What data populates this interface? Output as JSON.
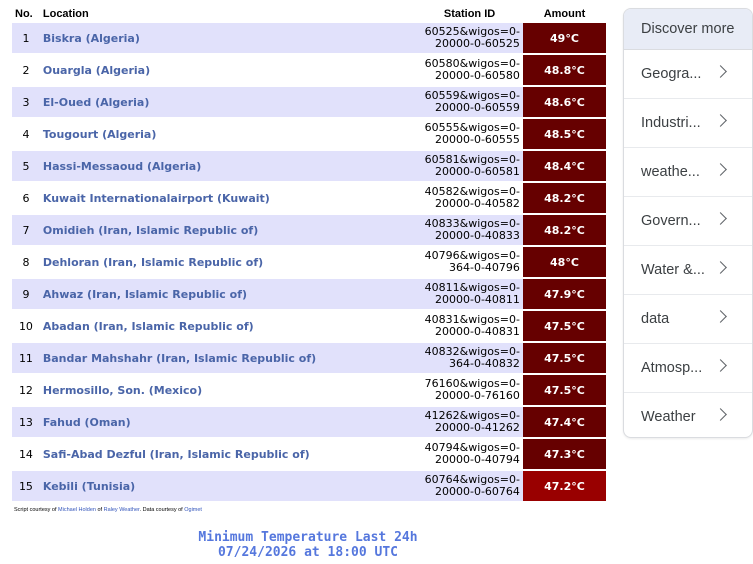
{
  "table": {
    "headers": {
      "no": "No.",
      "location": "Location",
      "station_id": "Station ID",
      "amount": "Amount"
    },
    "rows": [
      {
        "no": "1",
        "location": "Biskra (Algeria)",
        "id1": "60525&wigos=0-",
        "id2": "20000-0-60525",
        "amount": "49°C"
      },
      {
        "no": "2",
        "location": "Ouargla (Algeria)",
        "id1": "60580&wigos=0-",
        "id2": "20000-0-60580",
        "amount": "48.8°C"
      },
      {
        "no": "3",
        "location": "El-Oued (Algeria)",
        "id1": "60559&wigos=0-",
        "id2": "20000-0-60559",
        "amount": "48.6°C"
      },
      {
        "no": "4",
        "location": "Tougourt (Algeria)",
        "id1": "60555&wigos=0-",
        "id2": "20000-0-60555",
        "amount": "48.5°C"
      },
      {
        "no": "5",
        "location": "Hassi-Messaoud (Algeria)",
        "id1": "60581&wigos=0-",
        "id2": "20000-0-60581",
        "amount": "48.4°C"
      },
      {
        "no": "6",
        "location": "Kuwait Internationalairport (Kuwait)",
        "id1": "40582&wigos=0-",
        "id2": "20000-0-40582",
        "amount": "48.2°C"
      },
      {
        "no": "7",
        "location": "Omidieh (Iran, Islamic Republic of)",
        "id1": "40833&wigos=0-",
        "id2": "20000-0-40833",
        "amount": "48.2°C"
      },
      {
        "no": "8",
        "location": "Dehloran (Iran, Islamic Republic of)",
        "id1": "40796&wigos=0-",
        "id2": "364-0-40796",
        "amount": "48°C"
      },
      {
        "no": "9",
        "location": "Ahwaz (Iran, Islamic Republic of)",
        "id1": "40811&wigos=0-",
        "id2": "20000-0-40811",
        "amount": "47.9°C"
      },
      {
        "no": "10",
        "location": "Abadan (Iran, Islamic Republic of)",
        "id1": "40831&wigos=0-",
        "id2": "20000-0-40831",
        "amount": "47.5°C"
      },
      {
        "no": "11",
        "location": "Bandar Mahshahr (Iran, Islamic Republic of)",
        "id1": "40832&wigos=0-",
        "id2": "364-0-40832",
        "amount": "47.5°C"
      },
      {
        "no": "12",
        "location": "Hermosillo, Son. (Mexico)",
        "id1": "76160&wigos=0-",
        "id2": "20000-0-76160",
        "amount": "47.5°C"
      },
      {
        "no": "13",
        "location": "Fahud (Oman)",
        "id1": "41262&wigos=0-",
        "id2": "20000-0-41262",
        "amount": "47.4°C"
      },
      {
        "no": "14",
        "location": "Safi-Abad Dezful (Iran, Islamic Republic of)",
        "id1": "40794&wigos=0-",
        "id2": "20000-0-40794",
        "amount": "47.3°C"
      },
      {
        "no": "15",
        "location": "Kebili (Tunisia)",
        "id1": "60764&wigos=0-",
        "id2": "20000-0-60764",
        "amount": "47.2°C"
      }
    ]
  },
  "credit": {
    "prefix": "Script courtesy of ",
    "author": "Michael Holden",
    "of": " of ",
    "site": "Raley Weather",
    "data_text": ". Data courtesy of ",
    "data_source": "Ogimet"
  },
  "min_section": {
    "title": "Minimum Temperature Last 24h",
    "datetime": "07/24/2026 at 18:00 UTC"
  },
  "discover": {
    "header": "Discover more",
    "items": [
      {
        "label": "Geogra..."
      },
      {
        "label": "Industri..."
      },
      {
        "label": "weathe..."
      },
      {
        "label": "Govern..."
      },
      {
        "label": "Water &..."
      },
      {
        "label": "data"
      },
      {
        "label": "Atmosp..."
      },
      {
        "label": "Weather"
      }
    ]
  },
  "colors": {
    "row_alt": "#e1e1fb",
    "amount_bg": "#660000",
    "amount_bg_last": "#990000",
    "location_text": "#4a65a8",
    "title_text": "#5577dd"
  }
}
